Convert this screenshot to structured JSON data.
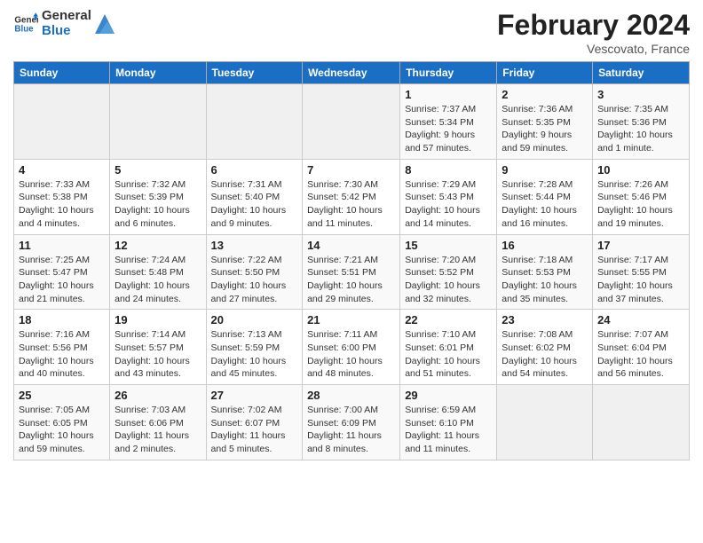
{
  "logo": {
    "name1": "General",
    "name2": "Blue"
  },
  "title": "February 2024",
  "subtitle": "Vescovato, France",
  "days_header": [
    "Sunday",
    "Monday",
    "Tuesday",
    "Wednesday",
    "Thursday",
    "Friday",
    "Saturday"
  ],
  "weeks": [
    [
      {
        "day": "",
        "info": ""
      },
      {
        "day": "",
        "info": ""
      },
      {
        "day": "",
        "info": ""
      },
      {
        "day": "",
        "info": ""
      },
      {
        "day": "1",
        "info": "Sunrise: 7:37 AM\nSunset: 5:34 PM\nDaylight: 9 hours and 57 minutes."
      },
      {
        "day": "2",
        "info": "Sunrise: 7:36 AM\nSunset: 5:35 PM\nDaylight: 9 hours and 59 minutes."
      },
      {
        "day": "3",
        "info": "Sunrise: 7:35 AM\nSunset: 5:36 PM\nDaylight: 10 hours and 1 minute."
      }
    ],
    [
      {
        "day": "4",
        "info": "Sunrise: 7:33 AM\nSunset: 5:38 PM\nDaylight: 10 hours and 4 minutes."
      },
      {
        "day": "5",
        "info": "Sunrise: 7:32 AM\nSunset: 5:39 PM\nDaylight: 10 hours and 6 minutes."
      },
      {
        "day": "6",
        "info": "Sunrise: 7:31 AM\nSunset: 5:40 PM\nDaylight: 10 hours and 9 minutes."
      },
      {
        "day": "7",
        "info": "Sunrise: 7:30 AM\nSunset: 5:42 PM\nDaylight: 10 hours and 11 minutes."
      },
      {
        "day": "8",
        "info": "Sunrise: 7:29 AM\nSunset: 5:43 PM\nDaylight: 10 hours and 14 minutes."
      },
      {
        "day": "9",
        "info": "Sunrise: 7:28 AM\nSunset: 5:44 PM\nDaylight: 10 hours and 16 minutes."
      },
      {
        "day": "10",
        "info": "Sunrise: 7:26 AM\nSunset: 5:46 PM\nDaylight: 10 hours and 19 minutes."
      }
    ],
    [
      {
        "day": "11",
        "info": "Sunrise: 7:25 AM\nSunset: 5:47 PM\nDaylight: 10 hours and 21 minutes."
      },
      {
        "day": "12",
        "info": "Sunrise: 7:24 AM\nSunset: 5:48 PM\nDaylight: 10 hours and 24 minutes."
      },
      {
        "day": "13",
        "info": "Sunrise: 7:22 AM\nSunset: 5:50 PM\nDaylight: 10 hours and 27 minutes."
      },
      {
        "day": "14",
        "info": "Sunrise: 7:21 AM\nSunset: 5:51 PM\nDaylight: 10 hours and 29 minutes."
      },
      {
        "day": "15",
        "info": "Sunrise: 7:20 AM\nSunset: 5:52 PM\nDaylight: 10 hours and 32 minutes."
      },
      {
        "day": "16",
        "info": "Sunrise: 7:18 AM\nSunset: 5:53 PM\nDaylight: 10 hours and 35 minutes."
      },
      {
        "day": "17",
        "info": "Sunrise: 7:17 AM\nSunset: 5:55 PM\nDaylight: 10 hours and 37 minutes."
      }
    ],
    [
      {
        "day": "18",
        "info": "Sunrise: 7:16 AM\nSunset: 5:56 PM\nDaylight: 10 hours and 40 minutes."
      },
      {
        "day": "19",
        "info": "Sunrise: 7:14 AM\nSunset: 5:57 PM\nDaylight: 10 hours and 43 minutes."
      },
      {
        "day": "20",
        "info": "Sunrise: 7:13 AM\nSunset: 5:59 PM\nDaylight: 10 hours and 45 minutes."
      },
      {
        "day": "21",
        "info": "Sunrise: 7:11 AM\nSunset: 6:00 PM\nDaylight: 10 hours and 48 minutes."
      },
      {
        "day": "22",
        "info": "Sunrise: 7:10 AM\nSunset: 6:01 PM\nDaylight: 10 hours and 51 minutes."
      },
      {
        "day": "23",
        "info": "Sunrise: 7:08 AM\nSunset: 6:02 PM\nDaylight: 10 hours and 54 minutes."
      },
      {
        "day": "24",
        "info": "Sunrise: 7:07 AM\nSunset: 6:04 PM\nDaylight: 10 hours and 56 minutes."
      }
    ],
    [
      {
        "day": "25",
        "info": "Sunrise: 7:05 AM\nSunset: 6:05 PM\nDaylight: 10 hours and 59 minutes."
      },
      {
        "day": "26",
        "info": "Sunrise: 7:03 AM\nSunset: 6:06 PM\nDaylight: 11 hours and 2 minutes."
      },
      {
        "day": "27",
        "info": "Sunrise: 7:02 AM\nSunset: 6:07 PM\nDaylight: 11 hours and 5 minutes."
      },
      {
        "day": "28",
        "info": "Sunrise: 7:00 AM\nSunset: 6:09 PM\nDaylight: 11 hours and 8 minutes."
      },
      {
        "day": "29",
        "info": "Sunrise: 6:59 AM\nSunset: 6:10 PM\nDaylight: 11 hours and 11 minutes."
      },
      {
        "day": "",
        "info": ""
      },
      {
        "day": "",
        "info": ""
      }
    ]
  ]
}
